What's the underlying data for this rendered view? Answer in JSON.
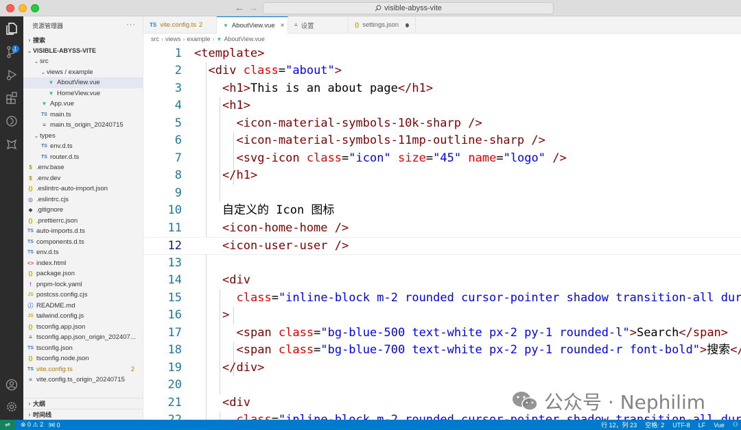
{
  "window": {
    "search_text": "visible-abyss-vite"
  },
  "activity_bar": {
    "explorer_badge": "1"
  },
  "sidebar": {
    "title": "资源管理器",
    "search_section": "搜索",
    "project_name": "VISIBLE-ABYSS-VITE",
    "tree": [
      {
        "label": "src",
        "kind": "folder"
      },
      {
        "label": "views / example",
        "kind": "folder"
      },
      {
        "label": "AboutView.vue",
        "kind": "vue"
      },
      {
        "label": "HomeView.vue",
        "kind": "vue"
      },
      {
        "label": "App.vue",
        "kind": "vue"
      },
      {
        "label": "main.ts",
        "kind": "ts",
        "icon_text": "TS"
      },
      {
        "label": "main.ts_origin_20240715",
        "kind": "plain",
        "icon_text": "≡"
      },
      {
        "label": "types",
        "kind": "folder"
      },
      {
        "label": "env.d.ts",
        "kind": "ts",
        "icon_text": "TS"
      },
      {
        "label": "router.d.ts",
        "kind": "ts",
        "icon_text": "TS"
      },
      {
        "label": ".env.base",
        "kind": "env",
        "icon_text": "$"
      },
      {
        "label": ".env.dev",
        "kind": "env",
        "icon_text": "$"
      },
      {
        "label": ".eslintrc-auto-import.json",
        "kind": "json",
        "icon_text": "{}"
      },
      {
        "label": ".eslintrc.cjs",
        "kind": "eslint",
        "icon_text": "◎"
      },
      {
        "label": ".gitignore",
        "kind": "git",
        "icon_text": "◆"
      },
      {
        "label": ".prettierrc.json",
        "kind": "json",
        "icon_text": "{}"
      },
      {
        "label": "auto-imports.d.ts",
        "kind": "ts",
        "icon_text": "TS"
      },
      {
        "label": "components.d.ts",
        "kind": "ts",
        "icon_text": "TS"
      },
      {
        "label": "env.d.ts",
        "kind": "ts",
        "icon_text": "TS"
      },
      {
        "label": "index.html",
        "kind": "html",
        "icon_text": "<>"
      },
      {
        "label": "package.json",
        "kind": "json",
        "icon_text": "{}"
      },
      {
        "label": "pnpm-lock.yaml",
        "kind": "yaml",
        "icon_text": "!"
      },
      {
        "label": "postcss.config.cjs",
        "kind": "js",
        "icon_text": "JS"
      },
      {
        "label": "README.md",
        "kind": "info",
        "icon_text": "ⓘ"
      },
      {
        "label": "tailwind.config.js",
        "kind": "js",
        "icon_text": "JS"
      },
      {
        "label": "tsconfig.app.json",
        "kind": "json",
        "icon_text": "{}"
      },
      {
        "label": "tsconfig.app.json_origin_202407...",
        "kind": "plain",
        "icon_text": "≡"
      },
      {
        "label": "tsconfig.json",
        "kind": "ts",
        "icon_text": "TS"
      },
      {
        "label": "tsconfig.node.json",
        "kind": "json",
        "icon_text": "{}"
      },
      {
        "label": "vite.config.ts",
        "kind": "ts",
        "icon_text": "TS",
        "count": "2"
      },
      {
        "label": "vite.config.ts_origin_20240715",
        "kind": "plain",
        "icon_text": "≡"
      }
    ],
    "outline_section": "大纲",
    "timeline_section": "时间线"
  },
  "tabs": [
    {
      "label": "vite.config.ts",
      "icon": "TS",
      "extra": "2"
    },
    {
      "label": "AboutView.vue",
      "icon": "V",
      "extra": "×"
    },
    {
      "label": "设置",
      "icon": "≡",
      "extra": ""
    },
    {
      "label": "settings.json",
      "icon": "{}",
      "extra": ""
    }
  ],
  "breadcrumb": [
    "src",
    "views",
    "example",
    "AboutView.vue"
  ],
  "editor": {
    "current_line": 12,
    "lines": [
      {
        "n": "1",
        "indent": 0,
        "parts": [
          [
            "tag",
            "<template>"
          ]
        ]
      },
      {
        "n": "2",
        "indent": 1,
        "parts": [
          [
            "tag",
            "<div "
          ],
          [
            "attr",
            "class"
          ],
          [
            "plain",
            "="
          ],
          [
            "str",
            "\"about\""
          ],
          [
            "tag",
            ">"
          ]
        ]
      },
      {
        "n": "3",
        "indent": 2,
        "parts": [
          [
            "tag",
            "<h1>"
          ],
          [
            "plain",
            "This is an about page"
          ],
          [
            "tag",
            "</h1>"
          ]
        ]
      },
      {
        "n": "4",
        "indent": 2,
        "parts": [
          [
            "tag",
            "<h1>"
          ]
        ]
      },
      {
        "n": "5",
        "indent": 3,
        "parts": [
          [
            "tag",
            "<icon-material-symbols-10k-sharp />"
          ]
        ]
      },
      {
        "n": "6",
        "indent": 3,
        "parts": [
          [
            "tag",
            "<icon-material-symbols-11mp-outline-sharp />"
          ]
        ]
      },
      {
        "n": "7",
        "indent": 3,
        "parts": [
          [
            "tag",
            "<svg-icon "
          ],
          [
            "attr",
            "class"
          ],
          [
            "plain",
            "="
          ],
          [
            "str",
            "\"icon\""
          ],
          [
            "plain",
            " "
          ],
          [
            "attr",
            "size"
          ],
          [
            "plain",
            "="
          ],
          [
            "str",
            "\"45\""
          ],
          [
            "plain",
            " "
          ],
          [
            "attr",
            "name"
          ],
          [
            "plain",
            "="
          ],
          [
            "str",
            "\"logo\""
          ],
          [
            "tag",
            " />"
          ]
        ]
      },
      {
        "n": "8",
        "indent": 2,
        "parts": [
          [
            "tag",
            "</h1>"
          ]
        ]
      },
      {
        "n": "9",
        "indent": 0,
        "parts": []
      },
      {
        "n": "10",
        "indent": 2,
        "parts": [
          [
            "plain",
            "自定义的 Icon 图标"
          ]
        ]
      },
      {
        "n": "11",
        "indent": 2,
        "parts": [
          [
            "tag",
            "<icon-home-home />"
          ]
        ]
      },
      {
        "n": "12",
        "indent": 2,
        "parts": [
          [
            "tag",
            "<icon-user-user />"
          ]
        ]
      },
      {
        "n": "13",
        "indent": 0,
        "parts": []
      },
      {
        "n": "14",
        "indent": 2,
        "parts": [
          [
            "tag",
            "<div"
          ]
        ]
      },
      {
        "n": "15",
        "indent": 3,
        "parts": [
          [
            "attr",
            "class"
          ],
          [
            "plain",
            "="
          ],
          [
            "str",
            "\"inline-block m-2 rounded cursor-pointer shadow transition-all dur"
          ]
        ]
      },
      {
        "n": "16",
        "indent": 2,
        "parts": [
          [
            "tag",
            ">"
          ]
        ]
      },
      {
        "n": "17",
        "indent": 3,
        "parts": [
          [
            "tag",
            "<span "
          ],
          [
            "attr",
            "class"
          ],
          [
            "plain",
            "="
          ],
          [
            "str",
            "\"bg-blue-500 text-white px-2 py-1 rounded-l\""
          ],
          [
            "tag",
            ">"
          ],
          [
            "plain",
            "Search"
          ],
          [
            "tag",
            "</span>"
          ]
        ]
      },
      {
        "n": "18",
        "indent": 3,
        "parts": [
          [
            "tag",
            "<span "
          ],
          [
            "attr",
            "class"
          ],
          [
            "plain",
            "="
          ],
          [
            "str",
            "\"bg-blue-700 text-white px-2 py-1 rounded-r font-bold\""
          ],
          [
            "tag",
            ">"
          ],
          [
            "plain",
            "搜索"
          ],
          [
            "tag",
            "</"
          ]
        ]
      },
      {
        "n": "19",
        "indent": 2,
        "parts": [
          [
            "tag",
            "</div>"
          ]
        ]
      },
      {
        "n": "20",
        "indent": 0,
        "parts": []
      },
      {
        "n": "21",
        "indent": 2,
        "parts": [
          [
            "tag",
            "<div"
          ]
        ]
      },
      {
        "n": "22",
        "indent": 3,
        "parts": [
          [
            "attr",
            "class"
          ],
          [
            "plain",
            "="
          ],
          [
            "str",
            "\"inline-block m-2 rounded cursor-pointer shadow transition-all dur"
          ]
        ]
      }
    ]
  },
  "watermark": {
    "text": "公众号 · Nephilim"
  },
  "statusbar": {
    "problems": "⊗ 0 ⚠ 2",
    "ports": "⒲ 0",
    "position": "行 12，列 23",
    "spaces": "空格: 2",
    "encoding": "UTF-8",
    "eol": "LF",
    "language": "Vue"
  }
}
